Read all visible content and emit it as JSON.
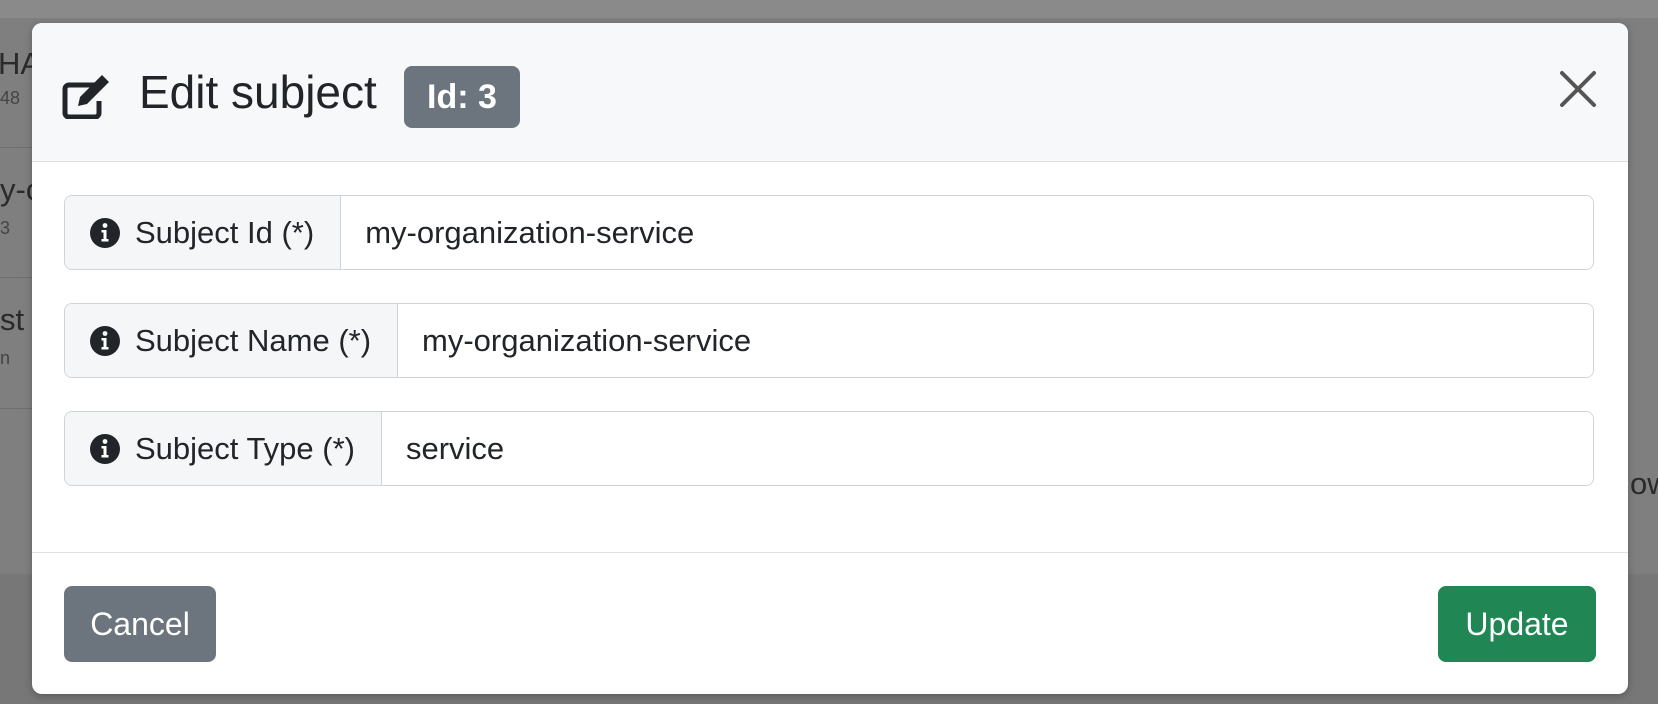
{
  "background": {
    "fragments": [
      "HA",
      "48",
      "y-c",
      "3",
      "st",
      "n",
      "ow"
    ]
  },
  "modal": {
    "title": "Edit subject",
    "badge": "Id: 3",
    "fields": [
      {
        "label": "Subject Id (*)",
        "value": "my-organization-service"
      },
      {
        "label": "Subject Name (*)",
        "value": "my-organization-service"
      },
      {
        "label": "Subject Type (*)",
        "value": "service"
      }
    ],
    "buttons": {
      "cancel": "Cancel",
      "update": "Update"
    }
  },
  "colors": {
    "badge": "#6c757d",
    "cancel": "#6c757d",
    "update": "#1f8654",
    "overlay": "#7f7f7f"
  },
  "icons": {
    "header": "edit-icon",
    "close": "close-icon",
    "field": "info-circle-icon"
  }
}
